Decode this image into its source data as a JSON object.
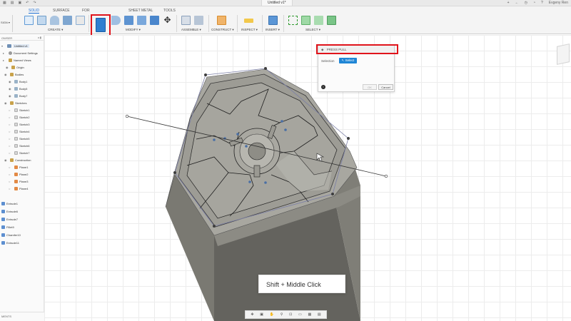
{
  "titlebar": {
    "document_title": "Untitled v1*",
    "user_name": "Evgeny Ren"
  },
  "ribbon": {
    "workspace": "SIGN",
    "tabs": [
      "SOLID",
      "SURFACE",
      "FOR",
      "SHEET METAL",
      "TOOLS"
    ],
    "groups": [
      "CREATE",
      "MODIFY",
      "ASSEMBLE",
      "CONSTRUCT",
      "INSPECT",
      "INSERT",
      "SELECT"
    ]
  },
  "browser": {
    "header": "OWSER",
    "root": "Untitled v1",
    "document_settings": "Document Settings",
    "named_views": "Named Views",
    "origin": "Origin",
    "bodies": "Bodies",
    "body_items": [
      "Body1",
      "Body5",
      "Body7"
    ],
    "sketches": "Sketches",
    "sketch_items": [
      "Sketch1",
      "Sketch2",
      "Sketch3",
      "Sketch4",
      "Sketch5",
      "Sketch6",
      "Sketch7"
    ],
    "construction": "Construction",
    "plane_items": [
      "Plane1",
      "Plane2",
      "Plane3",
      "Plane4"
    ],
    "timeline_items": [
      "Extrude1",
      "Extrude6",
      "Extrude7",
      "Fillet9",
      "Chamfer10",
      "Extrude11"
    ],
    "comments": "MENTS"
  },
  "dialog": {
    "title": "PRESS PULL",
    "selection_label": "Selection",
    "select_button": "Select",
    "ok": "OK",
    "cancel": "Cancel"
  },
  "hint": "Shift + Middle Click",
  "colors": {
    "accent": "#1b6fd6",
    "highlight_red": "#e0141b",
    "select_button_blue": "#1f86d6",
    "model_face": "#9a9a92",
    "model_side": "#6e6d67"
  }
}
